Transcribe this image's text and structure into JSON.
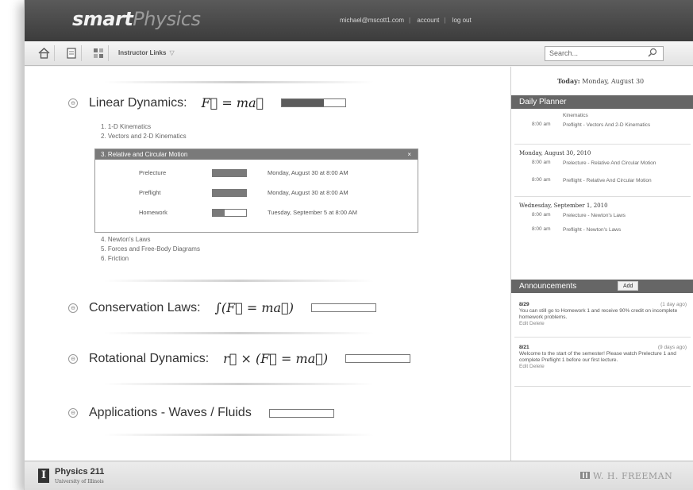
{
  "header": {
    "logo_part1": "smart",
    "logo_part2": "Physics",
    "user_email": "michael@mscott1.com",
    "account_link": "account",
    "logout_link": "log out"
  },
  "toolbar": {
    "home_icon": "home-icon",
    "page_icon": "page-icon",
    "grid_icon": "grid-icon",
    "instructor_links": "Instructor Links",
    "search_placeholder": "Search...",
    "search_icon": "search-icon"
  },
  "topics": [
    {
      "title": "Linear Dynamics:",
      "formula": "F⃗ = ma⃗",
      "progress": 0.66
    },
    {
      "title": "Conservation Laws:",
      "formula": "∫(F⃗ = ma⃗)",
      "progress": 0
    },
    {
      "title": "Rotational Dynamics:",
      "formula": "r⃗ × (F⃗ = ma⃗)",
      "progress": 0
    },
    {
      "title": "Applications - Waves / Fluids",
      "formula": "",
      "progress": 0
    }
  ],
  "units_before": [
    "1. 1-D Kinematics",
    "2. Vectors and 2-D Kinematics"
  ],
  "open_unit": {
    "title": "3. Relative and Circular Motion",
    "close": "×",
    "activities": [
      {
        "name": "Prelecture",
        "progress": 1.0,
        "due": "Monday, August 30 at 8:00 AM"
      },
      {
        "name": "Preflight",
        "progress": 1.0,
        "due": "Monday, August 30 at 8:00 AM"
      },
      {
        "name": "Homework",
        "progress": 0.35,
        "due": "Tuesday, September 5 at 8:00 AM"
      }
    ]
  },
  "units_after": [
    "4. Newton's Laws",
    "5. Forces and Free-Body Diagrams",
    "6. Friction"
  ],
  "sidebar": {
    "today_label": "Today:",
    "today_date": "Monday, August 30",
    "planner_title": "Daily Planner",
    "planner": {
      "top_item_tail": "Kinematics",
      "top_time": "8:00 am",
      "top_item": "Preflight - Vectors And 2-D Kinematics",
      "day1": "Monday, August 30, 2010",
      "day1_items": [
        {
          "time": "8:00 am",
          "text": "Prelecture - Relative And Circular Motion"
        },
        {
          "time": "8:00 am",
          "text": "Preflight - Relative And Circular Motion"
        }
      ],
      "day2": "Wednesday, September 1, 2010",
      "day2_items": [
        {
          "time": "8:00 am",
          "text": "Prelecture - Newton's Laws"
        },
        {
          "time": "8:00 am",
          "text": "Preflight - Newton's Laws"
        }
      ]
    },
    "announcements_title": "Announcements",
    "add_label": "Add",
    "announcements": [
      {
        "date": "8/29",
        "ago": "(1 day ago)",
        "text": "You can still go to Homework 1 and receive 90% credit on incomplete homework problems.",
        "actions": "Edit  Delete"
      },
      {
        "date": "8/21",
        "ago": "(9 days ago)",
        "text": "Welcome to the start of the semester! Please watch Prelecture 1 and complete Preflight 1 before our first lecture.",
        "actions": "Edit  Delete"
      }
    ]
  },
  "footer": {
    "logo_letter": "I",
    "course": "Physics 211",
    "university": "University of Illinois",
    "publisher": "W. H. FREEMAN"
  }
}
